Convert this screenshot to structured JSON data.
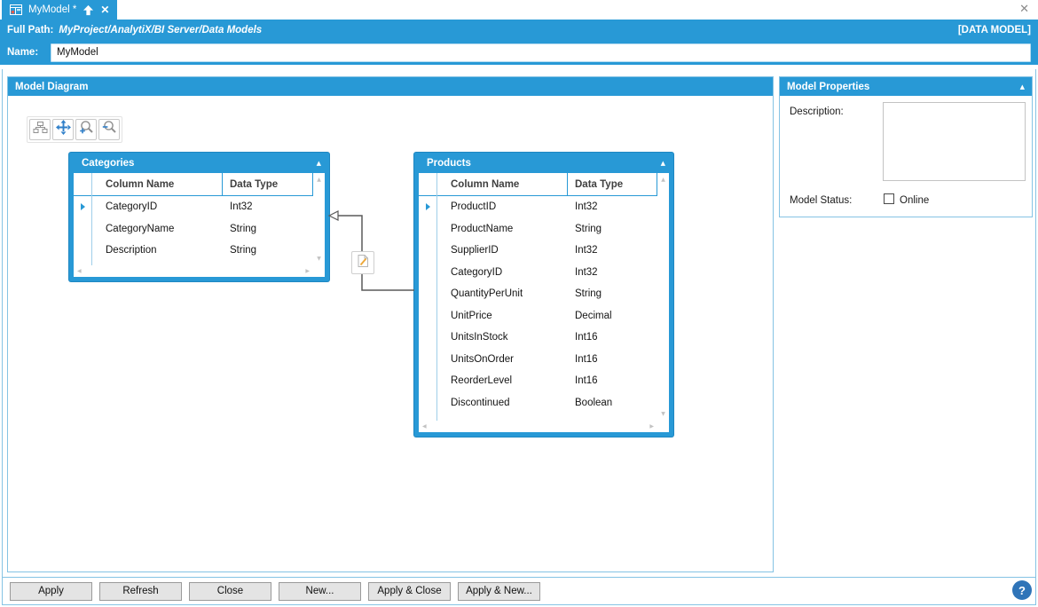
{
  "colors": {
    "accent": "#2899d6",
    "panel_border": "#85c3e4",
    "connector": "#5a5a5a",
    "help_button": "#2f74b8"
  },
  "window": {
    "close_glyph": "✕"
  },
  "tab": {
    "label": "MyModel *",
    "close_glyph": "✕",
    "icons": [
      "data-model-icon",
      "navigate-up-icon",
      "close-icon"
    ]
  },
  "path_bar": {
    "label": "Full Path:",
    "value": "MyProject/AnalytiX/BI Server/Data Models",
    "type_badge": "[DATA MODEL]"
  },
  "name_row": {
    "label": "Name:",
    "value": "MyModel"
  },
  "diagram_panel": {
    "title": "Model Diagram",
    "toolbar_icons": [
      "auto-layout-icon",
      "pan-icon",
      "zoom-in-icon",
      "zoom-out-icon"
    ],
    "tables": {
      "categories": {
        "title": "Categories",
        "column_headers": [
          "Column Name",
          "Data Type"
        ],
        "rows": [
          {
            "name": "CategoryID",
            "type": "Int32"
          },
          {
            "name": "CategoryName",
            "type": "String"
          },
          {
            "name": "Description",
            "type": "String"
          }
        ]
      },
      "products": {
        "title": "Products",
        "column_headers": [
          "Column Name",
          "Data Type"
        ],
        "rows": [
          {
            "name": "ProductID",
            "type": "Int32"
          },
          {
            "name": "ProductName",
            "type": "String"
          },
          {
            "name": "SupplierID",
            "type": "Int32"
          },
          {
            "name": "CategoryID",
            "type": "Int32"
          },
          {
            "name": "QuantityPerUnit",
            "type": "String"
          },
          {
            "name": "UnitPrice",
            "type": "Decimal"
          },
          {
            "name": "UnitsInStock",
            "type": "Int16"
          },
          {
            "name": "UnitsOnOrder",
            "type": "Int16"
          },
          {
            "name": "ReorderLevel",
            "type": "Int16"
          },
          {
            "name": "Discontinued",
            "type": "Boolean"
          }
        ]
      }
    },
    "relationship_badge_icon": "edit-relationship-icon"
  },
  "properties_panel": {
    "title": "Model Properties",
    "description_label": "Description:",
    "description_value": "",
    "status_label": "Model Status:",
    "status_option": "Online",
    "status_checked": false
  },
  "footer": {
    "buttons": [
      {
        "label": "Apply",
        "name": "apply-button"
      },
      {
        "label": "Refresh",
        "name": "refresh-button"
      },
      {
        "label": "Close",
        "name": "close-button"
      },
      {
        "label": "New...",
        "name": "new-button"
      },
      {
        "label": "Apply & Close",
        "name": "apply-close-button"
      },
      {
        "label": "Apply & New...",
        "name": "apply-new-button"
      }
    ],
    "help_glyph": "?"
  }
}
